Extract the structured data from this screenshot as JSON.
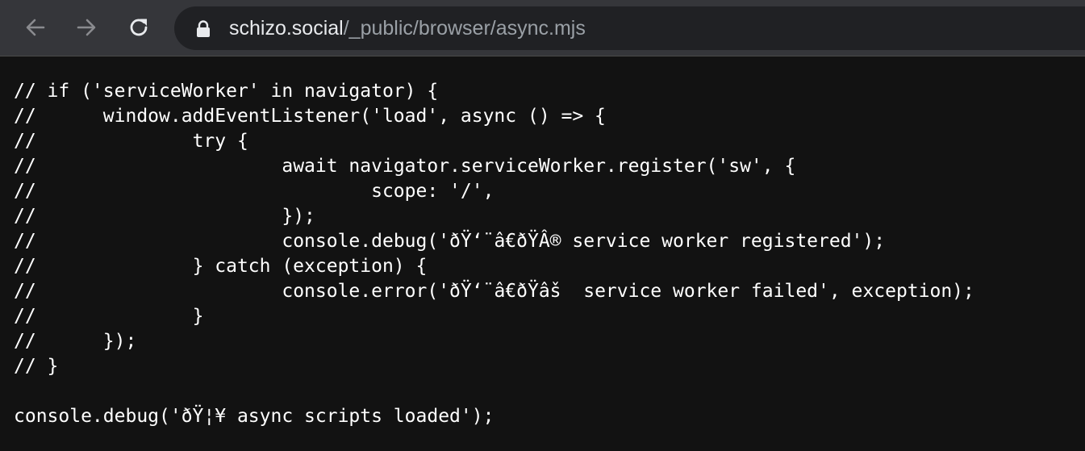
{
  "browser": {
    "back_icon": "arrow-left-icon",
    "forward_icon": "arrow-right-icon",
    "reload_icon": "reload-icon",
    "lock_icon": "lock-icon",
    "url_host": "schizo.social",
    "url_path": "/_public/browser/async.mjs"
  },
  "code_lines": [
    "// if ('serviceWorker' in navigator) {",
    "//\twindow.addEventListener('load', async () => {",
    "//\t\ttry {",
    "//\t\t\tawait navigator.serviceWorker.register('sw', {",
    "//\t\t\t\tscope: '/',",
    "//\t\t\t});",
    "//\t\t\tconsole.debug('ðŸ‘¨â€ðŸÂ® service worker registered');",
    "//\t\t} catch (exception) {",
    "//\t\t\tconsole.error('ðŸ‘¨â€ðŸâš  service worker failed', exception);",
    "//\t\t}",
    "//\t});",
    "// }",
    "",
    "console.debug('ðŸ¦¥ async scripts loaded');"
  ]
}
